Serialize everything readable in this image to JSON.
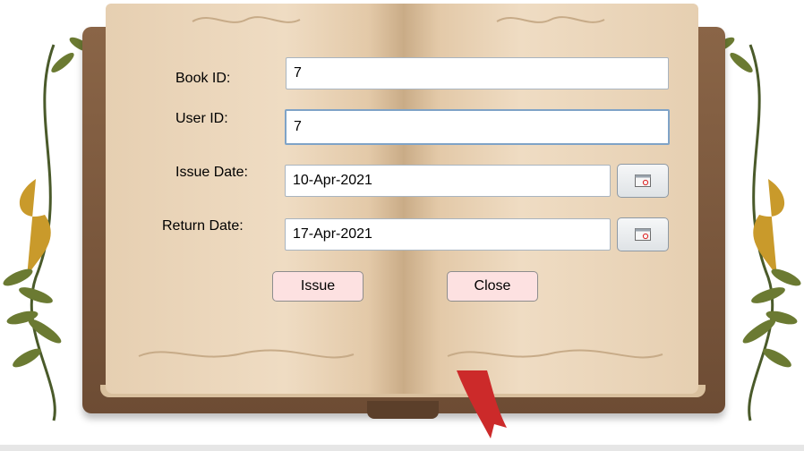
{
  "form": {
    "book_id": {
      "label": "Book ID:",
      "value": "7"
    },
    "user_id": {
      "label": "User ID:",
      "value": "7"
    },
    "issue_date": {
      "label": "Issue Date:",
      "value": "10-Apr-2021"
    },
    "return_date": {
      "label": "Return Date:",
      "value": "17-Apr-2021"
    }
  },
  "actions": {
    "issue": "Issue",
    "close": "Close"
  },
  "icons": {
    "date_picker": "calendar-icon",
    "bookmark": "bookmark-ribbon",
    "decor": "leaf-ornament"
  },
  "colors": {
    "button_bg": "#fde1e1",
    "page": "#efdcc3",
    "cover": "#7a573c",
    "ribbon": "#cc2a2a"
  }
}
